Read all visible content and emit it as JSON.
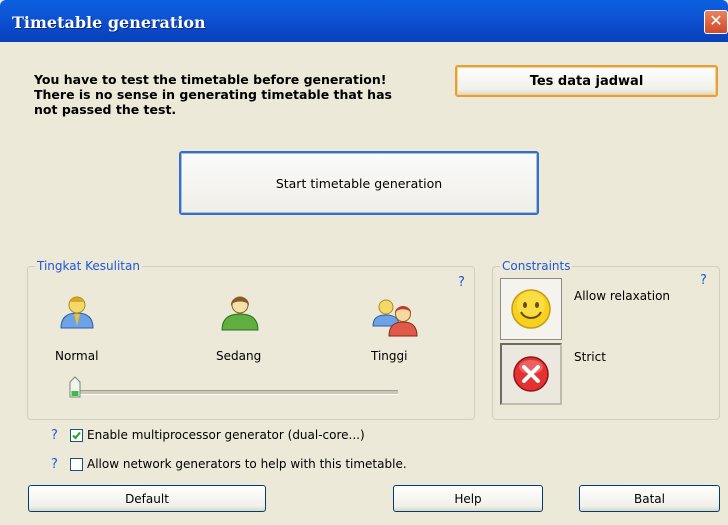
{
  "window": {
    "title": "Timetable generation",
    "close_symbol": "✕"
  },
  "warning": {
    "line1": "You have to test the timetable before generation!",
    "line2": "There is no sense in generating timetable that has",
    "line3": "not passed the test."
  },
  "buttons": {
    "test": "Tes data jadwal",
    "start": "Start timetable generation",
    "default": "Default",
    "help": "Help",
    "cancel": "Batal"
  },
  "difficulty": {
    "legend": "Tingkat Kesulitan",
    "help": "?",
    "levels": [
      "Normal",
      "Sedang",
      "Tinggi"
    ],
    "selected_index": 0
  },
  "constraints": {
    "legend": "Constraints",
    "help": "?",
    "options": [
      "Allow relaxation",
      "Strict"
    ]
  },
  "options": {
    "multiprocessor": {
      "help": "?",
      "label": "Enable multiprocessor generator (dual-core...)",
      "checked": true
    },
    "network": {
      "help": "?",
      "label": "Allow network generators to help with this timetable.",
      "checked": false
    }
  },
  "colors": {
    "titlebar": "#0a54d8",
    "group_legend": "#1f56d8",
    "focus_border": "#e5a03a"
  }
}
